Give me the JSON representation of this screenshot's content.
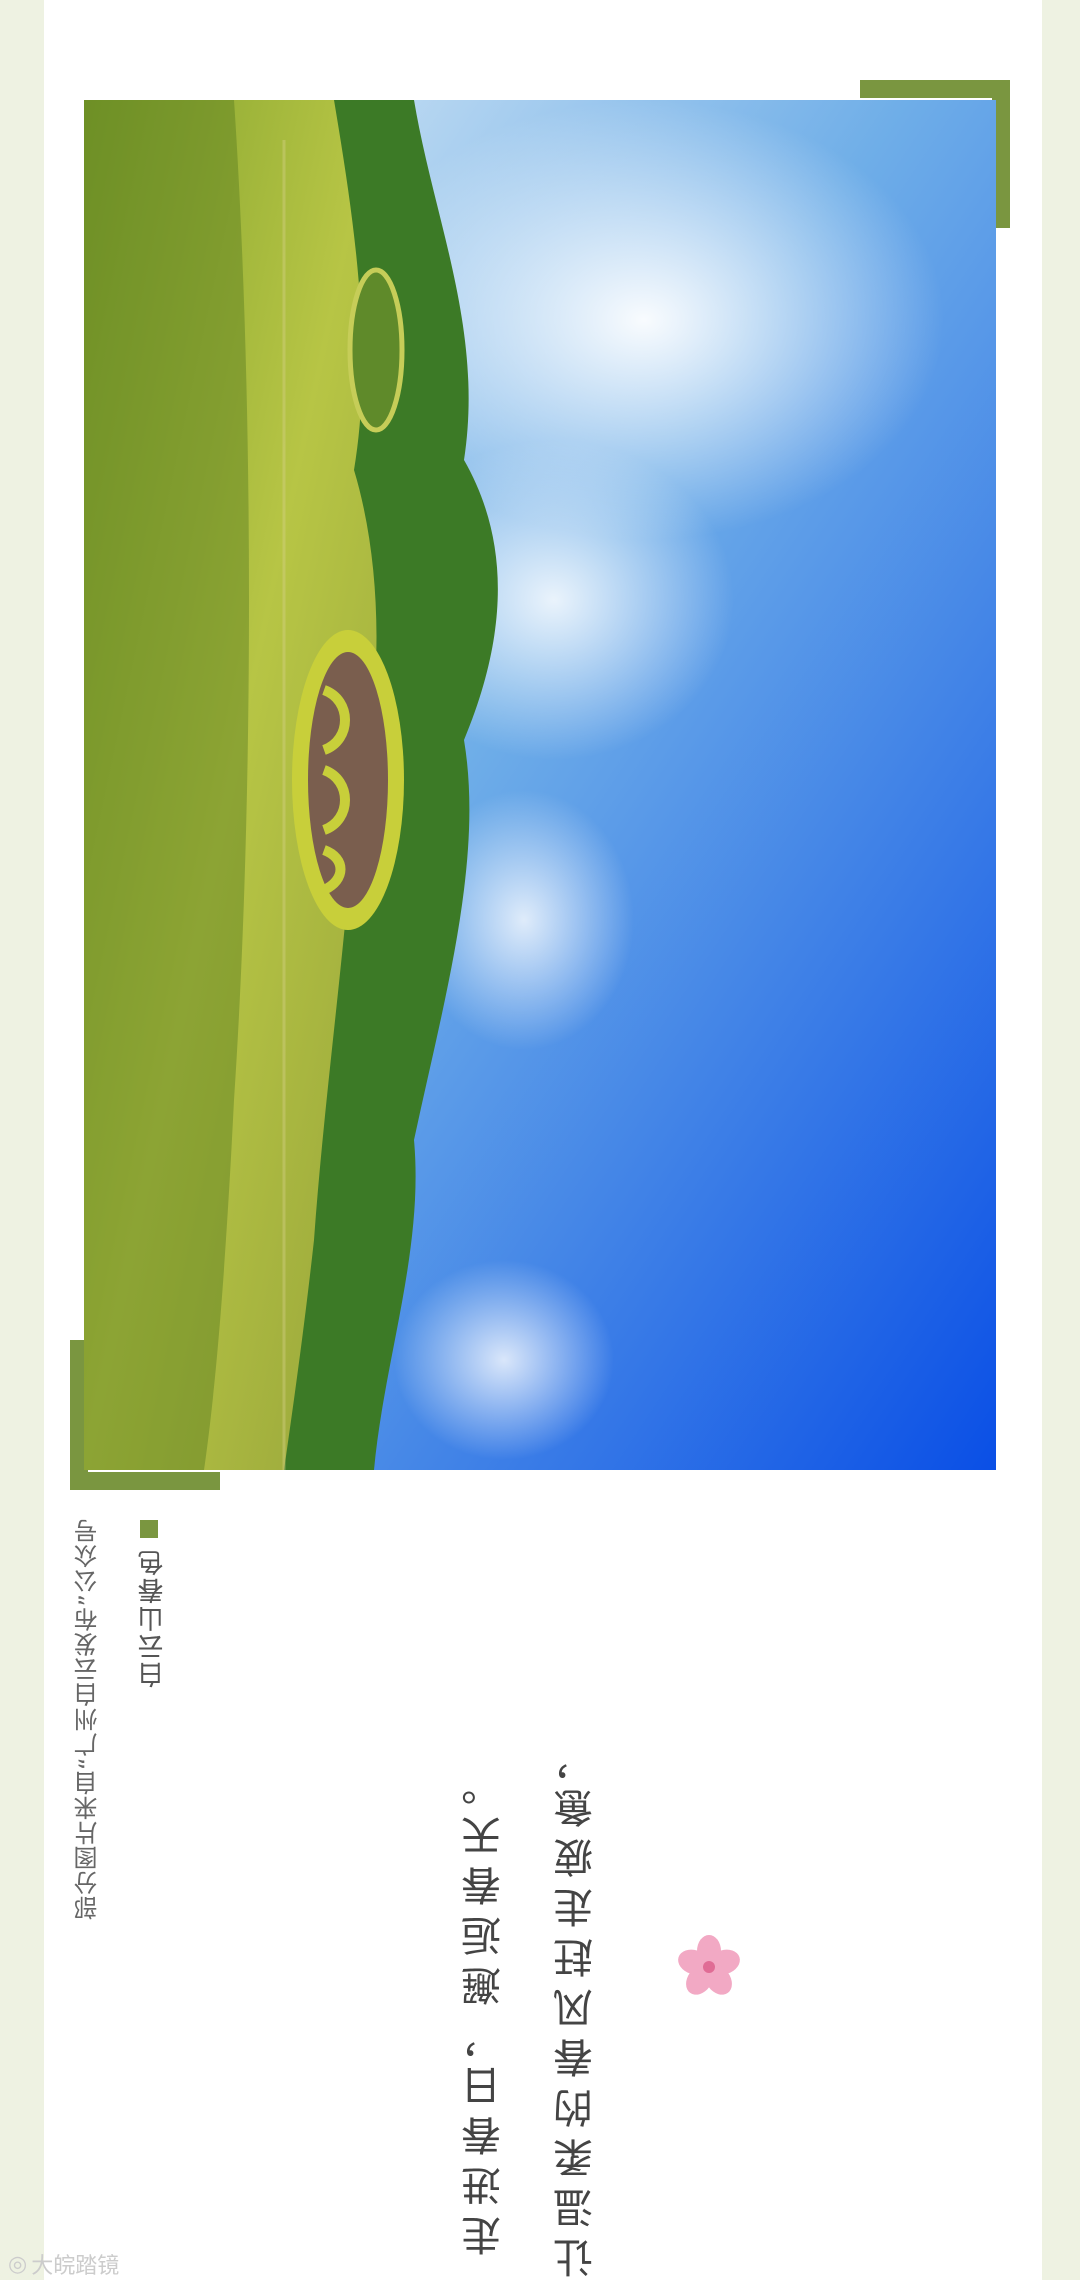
{
  "image": {
    "icon": "park-landscape-photo"
  },
  "caption": {
    "text": "白云山春色"
  },
  "credit": {
    "text": "部分图片来自“广州白云发布”公众号"
  },
  "poem": {
    "line1": "让温柔的春风赶走疲惫，",
    "line2": "走进春日，邂逅春天。"
  },
  "decoration": {
    "flower_icon": "pink-flower-icon",
    "accent_color": "#7a9640"
  },
  "watermark": {
    "text": "大皖踏镜"
  }
}
